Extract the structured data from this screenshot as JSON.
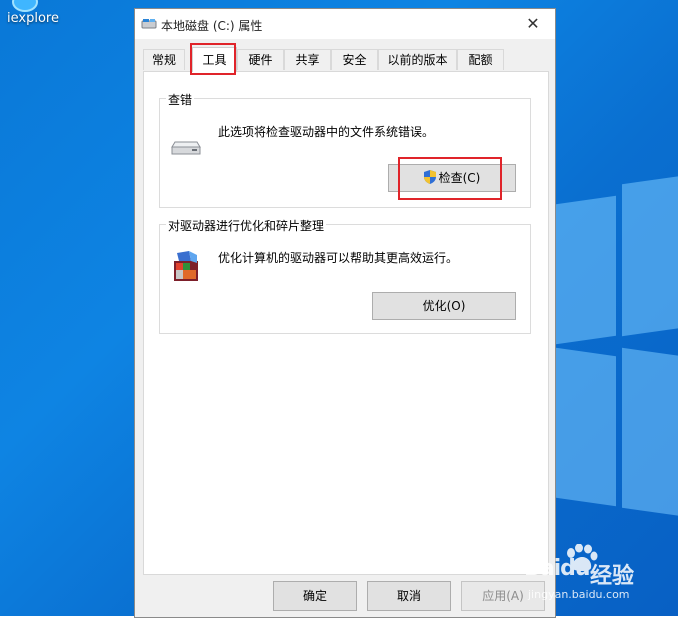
{
  "desktop": {
    "icon_label": "iexplore"
  },
  "dialog": {
    "title": "本地磁盘 (C:) 属性",
    "close_glyph": "✕",
    "tabs": [
      {
        "label": "常规"
      },
      {
        "label": "工具",
        "active": true
      },
      {
        "label": "硬件"
      },
      {
        "label": "共享"
      },
      {
        "label": "安全"
      },
      {
        "label": "以前的版本"
      },
      {
        "label": "配额"
      }
    ],
    "error_check": {
      "legend": "查错",
      "description": "此选项将检查驱动器中的文件系统错误。",
      "button_label": "检查(C)",
      "icon": "drive-icon",
      "button_icon": "uac-shield-icon"
    },
    "optimize": {
      "legend": "对驱动器进行优化和碎片整理",
      "description": "优化计算机的驱动器可以帮助其更高效运行。",
      "button_label": "优化(O)",
      "icon": "defrag-icon"
    },
    "footer": {
      "ok": "确定",
      "cancel": "取消",
      "apply": "应用(A)"
    }
  },
  "watermark": {
    "brand": "Baidu",
    "brand_cn": "经验",
    "sub": "jingyan.baidu.com"
  },
  "colors": {
    "desktop_blue": "#0a78d7",
    "highlight_red": "#e0242a",
    "dialog_bg": "#f0f0f0"
  }
}
